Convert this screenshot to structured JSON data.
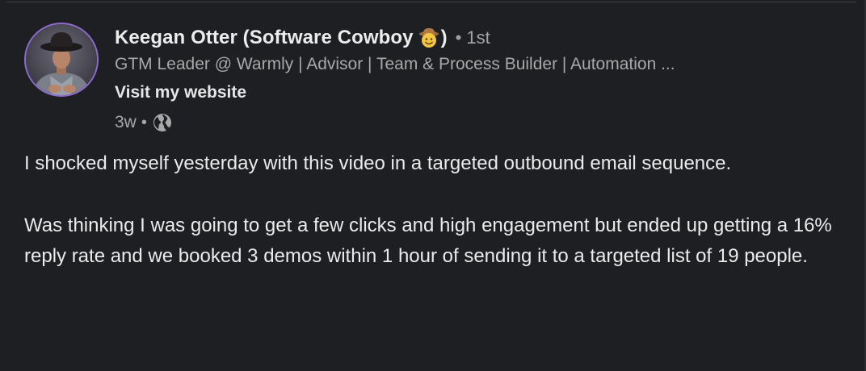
{
  "author": {
    "name": "Keegan Otter (Software Cowboy",
    "name_close": ")",
    "name_icon": "cowboy-face-emoji",
    "degree_separator": "•",
    "degree": "1st",
    "headline": "GTM Leader @ Warmly | Advisor | Team & Process Builder | Automation ...",
    "website_label": "Visit my website",
    "avatar_ring_color": "#8e6bcf"
  },
  "meta": {
    "time": "3w",
    "separator": "•",
    "visibility_icon": "globe-icon"
  },
  "post": {
    "paragraphs": [
      "I shocked myself yesterday with this video in a targeted outbound email sequence.",
      "Was thinking I was going to get a few clicks and high engagement but ended up getting a 16% reply rate and we booked 3 demos within 1 hour of sending it to a targeted list of 19 people."
    ]
  },
  "colors": {
    "background": "#1d1f22",
    "text_primary": "#ebebeb",
    "text_secondary": "#a8a8a8"
  }
}
